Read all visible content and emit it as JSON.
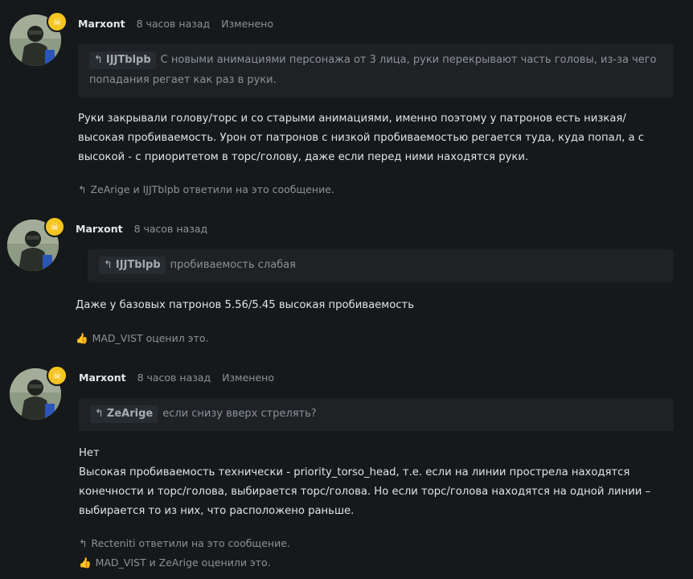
{
  "posts": [
    {
      "author": "Marxont",
      "time": "8 часов назад",
      "edited": "Изменено",
      "quote_author": "IJJTblpb",
      "quote_text": "С новыми анимациями персонажа от 3 лица, руки перекрывают часть головы, из-за чего попадания регает как раз в руки.",
      "body": [
        "Руки закрывали голову/торс и со старыми анимациями, именно поэтому у патронов есть низкая/высокая пробиваемость. Урон от патронов с низкой пробиваемостью регается туда, куда попал, а с высокой - с приоритетом в торс/голову, даже если перед ними находятся руки."
      ],
      "replies": "ZeArige и IJJTblpb ответили на это сообщение."
    },
    {
      "author": "Marxont",
      "time": "8 часов назад",
      "quote_author": "IJJTblpb",
      "quote_text": "пробиваемость слабая",
      "body": [
        "Даже у базовых патронов 5.56/5.45 высокая пробиваемость"
      ],
      "likes": "MAD_VIST оценил это."
    },
    {
      "author": "Marxont",
      "time": "8 часов назад",
      "edited": "Изменено",
      "quote_author": "ZeArige",
      "quote_text": "если снизу вверх стрелять?",
      "body": [
        "Нет",
        "Высокая пробиваемость технически - priority_torso_head, т.е. если на линии прострела находятся конечности и торс/голова, выбирается торс/голова. Но если торс/голова находятся на одной линии – выбирается то из них, что расположено раньше."
      ],
      "replies": "Recteniti ответили на это сообщение.",
      "likes": "MAD_VIST и ZeArige оценили это."
    }
  ],
  "icons": {
    "reply": "reply-arrow-icon",
    "like": "thumbs-up-icon",
    "badge": "skull-icon"
  },
  "colors": {
    "background": "#16191b",
    "quote_bg": "#1e2225",
    "badge": "#f5c521",
    "muted": "#8b9298"
  }
}
